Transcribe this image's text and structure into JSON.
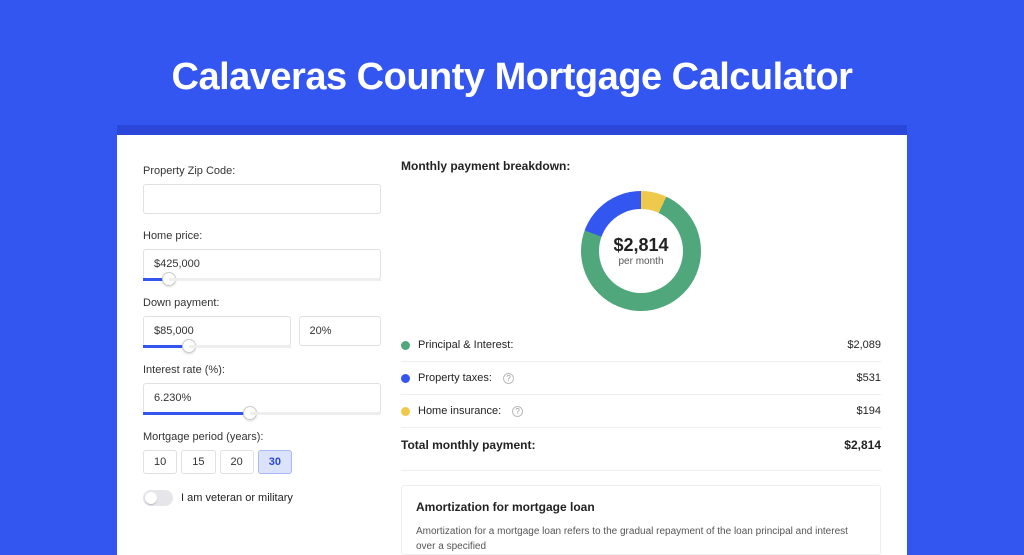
{
  "title": "Calaveras County Mortgage Calculator",
  "form": {
    "zip": {
      "label": "Property Zip Code:",
      "value": ""
    },
    "price": {
      "label": "Home price:",
      "value": "$425,000",
      "slider_pct": "11%"
    },
    "down": {
      "label": "Down payment:",
      "amount": "$85,000",
      "pct": "20%",
      "slider_pct": "31%"
    },
    "rate": {
      "label": "Interest rate (%):",
      "value": "6.230%",
      "slider_pct": "45%"
    },
    "period": {
      "label": "Mortgage period (years):",
      "options": [
        "10",
        "15",
        "20",
        "30"
      ],
      "selected": "30"
    },
    "veteran": {
      "label": "I am veteran or military",
      "on": false
    }
  },
  "breakdown": {
    "heading": "Monthly payment breakdown:",
    "donut": {
      "amount": "$2,814",
      "sub": "per month"
    },
    "rows": [
      {
        "color": "g",
        "label": "Principal & Interest:",
        "info": false,
        "value": "$2,089"
      },
      {
        "color": "b",
        "label": "Property taxes:",
        "info": true,
        "value": "$531"
      },
      {
        "color": "y",
        "label": "Home insurance:",
        "info": true,
        "value": "$194"
      }
    ],
    "total_label": "Total monthly payment:",
    "total_value": "$2,814"
  },
  "amort": {
    "title": "Amortization for mortgage loan",
    "body": "Amortization for a mortgage loan refers to the gradual repayment of the loan principal and interest over a specified"
  },
  "chart_data": {
    "type": "pie",
    "title": "Monthly payment breakdown",
    "series": [
      {
        "name": "Principal & Interest",
        "value": 2089,
        "color": "#4fa77b"
      },
      {
        "name": "Property taxes",
        "value": 531,
        "color": "#3456f0"
      },
      {
        "name": "Home insurance",
        "value": 194,
        "color": "#efc94c"
      }
    ],
    "total": 2814,
    "center_label": "$2,814 per month"
  }
}
